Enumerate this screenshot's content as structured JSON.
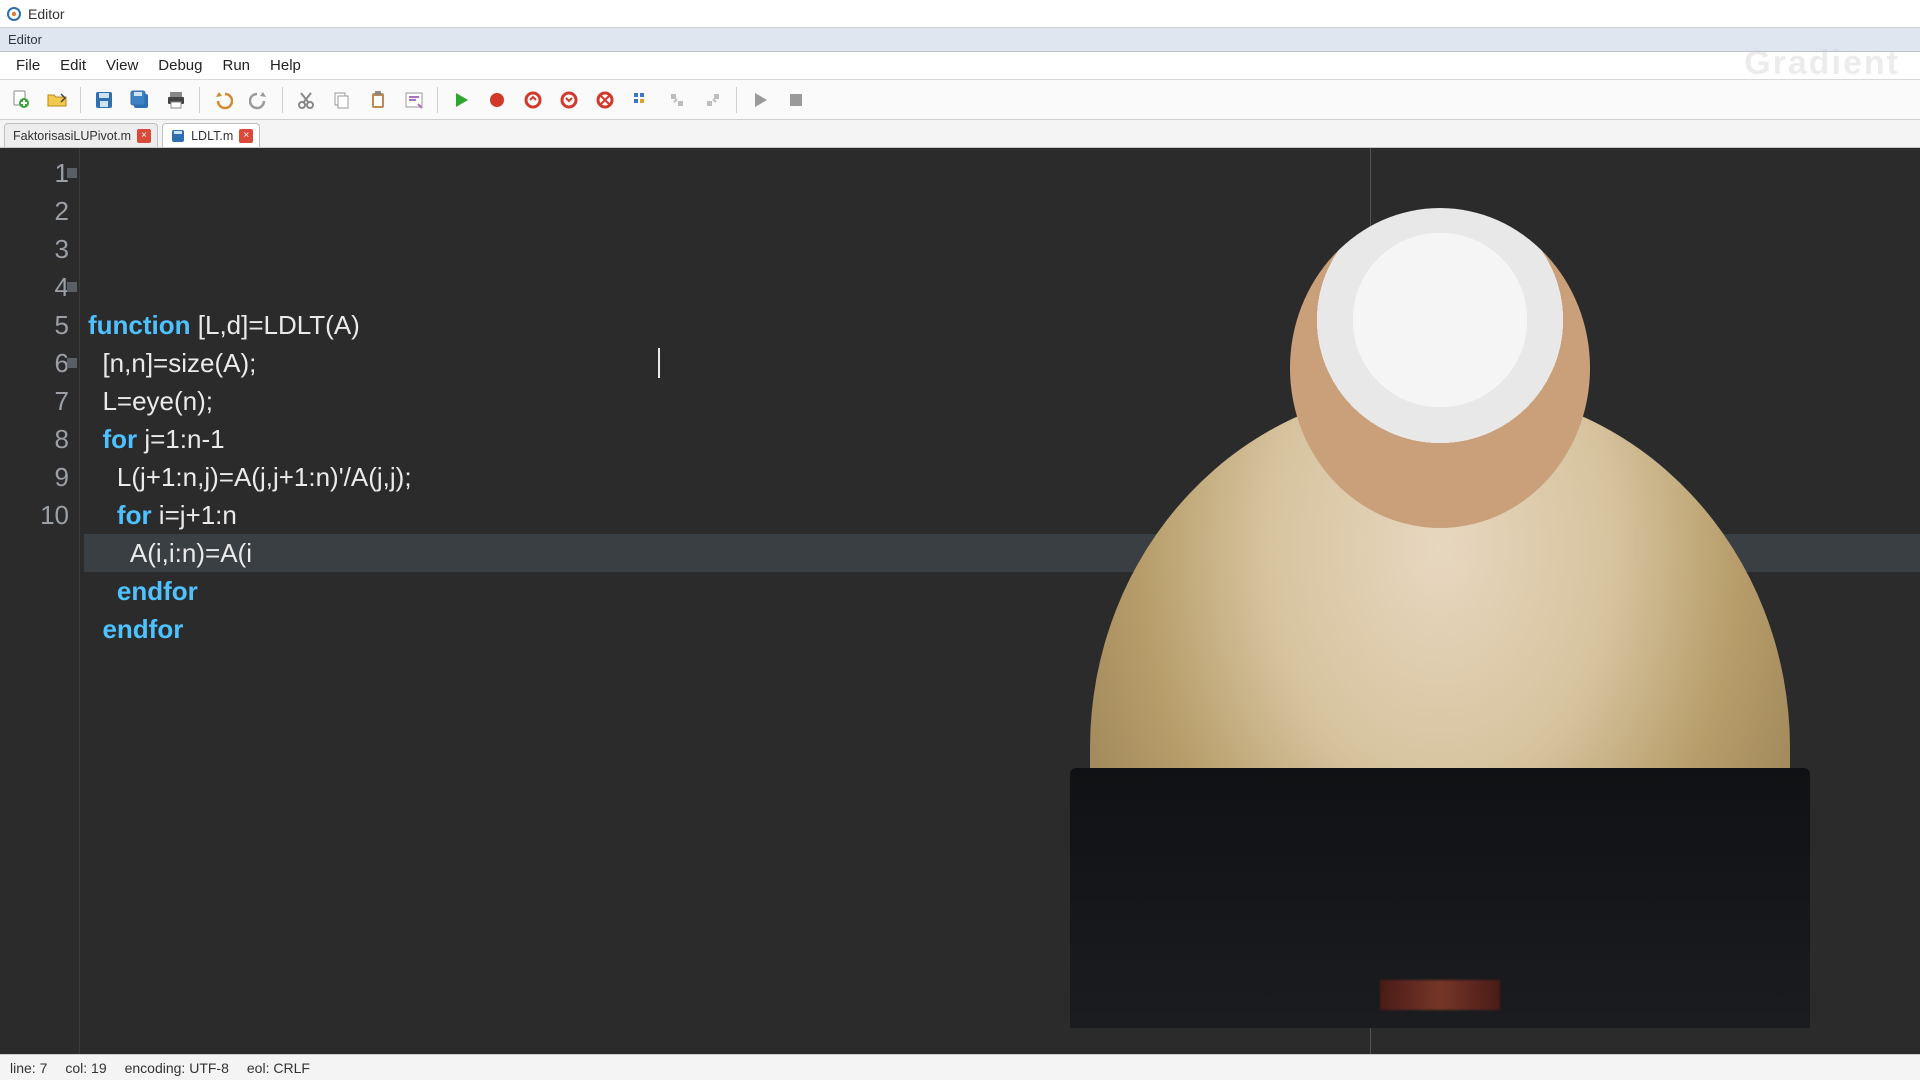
{
  "title": "Editor",
  "subtitle": "Editor",
  "menus": [
    "File",
    "Edit",
    "View",
    "Debug",
    "Run",
    "Help"
  ],
  "tabs": [
    {
      "label": "FaktorisasiLUPivot.m",
      "active": false,
      "has_disk_icon": false
    },
    {
      "label": "LDLT.m",
      "active": true,
      "has_disk_icon": true
    }
  ],
  "code_lines": [
    {
      "n": 1,
      "fold": true,
      "hl": false,
      "segments": [
        [
          "kw",
          "function"
        ],
        [
          "",
          " [L,d]=LDLT(A)"
        ]
      ]
    },
    {
      "n": 2,
      "fold": false,
      "hl": false,
      "segments": [
        [
          "",
          "  [n,n]=size(A);"
        ]
      ]
    },
    {
      "n": 3,
      "fold": false,
      "hl": false,
      "segments": [
        [
          "",
          "  L=eye(n);"
        ]
      ]
    },
    {
      "n": 4,
      "fold": true,
      "hl": false,
      "segments": [
        [
          "",
          "  "
        ],
        [
          "kw",
          "for"
        ],
        [
          "",
          " j=1:n-1"
        ]
      ]
    },
    {
      "n": 5,
      "fold": false,
      "hl": false,
      "segments": [
        [
          "",
          "    L(j+1:n,j)=A(j,j+1:n)'/A(j,j);"
        ]
      ]
    },
    {
      "n": 6,
      "fold": true,
      "hl": false,
      "segments": [
        [
          "",
          "    "
        ],
        [
          "kw",
          "for"
        ],
        [
          "",
          " i=j+1:n"
        ]
      ]
    },
    {
      "n": 7,
      "fold": false,
      "hl": true,
      "segments": [
        [
          "",
          "      A(i,i:n)=A(i"
        ]
      ]
    },
    {
      "n": 8,
      "fold": false,
      "hl": false,
      "segments": [
        [
          "",
          "    "
        ],
        [
          "kw",
          "endfor"
        ]
      ]
    },
    {
      "n": 9,
      "fold": false,
      "hl": false,
      "segments": [
        [
          "",
          "  "
        ],
        [
          "kw",
          "endfor"
        ]
      ]
    },
    {
      "n": 10,
      "fold": false,
      "hl": false,
      "segments": [
        [
          "",
          ""
        ]
      ]
    }
  ],
  "status": {
    "line": "line: 7",
    "col": "col: 19",
    "encoding": "encoding: UTF-8",
    "eol": "eol: CRLF"
  },
  "watermark": "Gradient"
}
